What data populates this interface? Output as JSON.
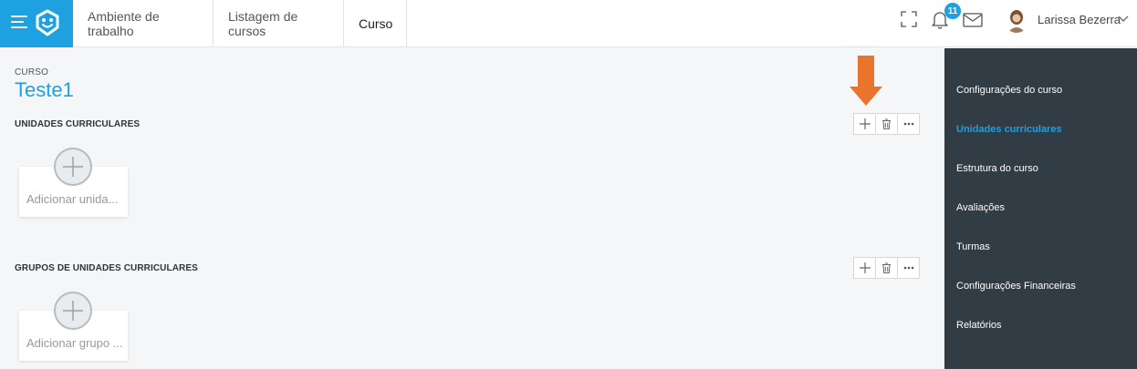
{
  "header": {
    "tabs": [
      {
        "label": "Ambiente de trabalho"
      },
      {
        "label": "Listagem de cursos"
      },
      {
        "label": "Curso"
      }
    ],
    "notifications_count": "11",
    "user": {
      "name": "Larissa Bezerra"
    }
  },
  "course": {
    "kicker": "CURSO",
    "title": "Teste1"
  },
  "sections": [
    {
      "label": "UNIDADES CURRICULARES",
      "add_card_text": "Adicionar unida..."
    },
    {
      "label": "GRUPOS DE UNIDADES CURRICULARES",
      "add_card_text": "Adicionar grupo ..."
    }
  ],
  "sidebar": {
    "items": [
      {
        "label": "Configurações do curso"
      },
      {
        "label": "Unidades curriculares",
        "active": true
      },
      {
        "label": "Estrutura do curso"
      },
      {
        "label": "Avaliações"
      },
      {
        "label": "Turmas"
      },
      {
        "label": "Configurações Financeiras"
      },
      {
        "label": "Relatórios"
      }
    ]
  },
  "colors": {
    "accent": "#1da1e0",
    "sidebar_bg": "#313c45",
    "annotation_arrow": "#e8742e"
  },
  "icons": [
    "menu-icon",
    "logo-icon",
    "fullscreen-icon",
    "bell-icon",
    "mail-icon",
    "chevron-down-icon",
    "plus-icon",
    "trash-icon",
    "more-icon"
  ]
}
